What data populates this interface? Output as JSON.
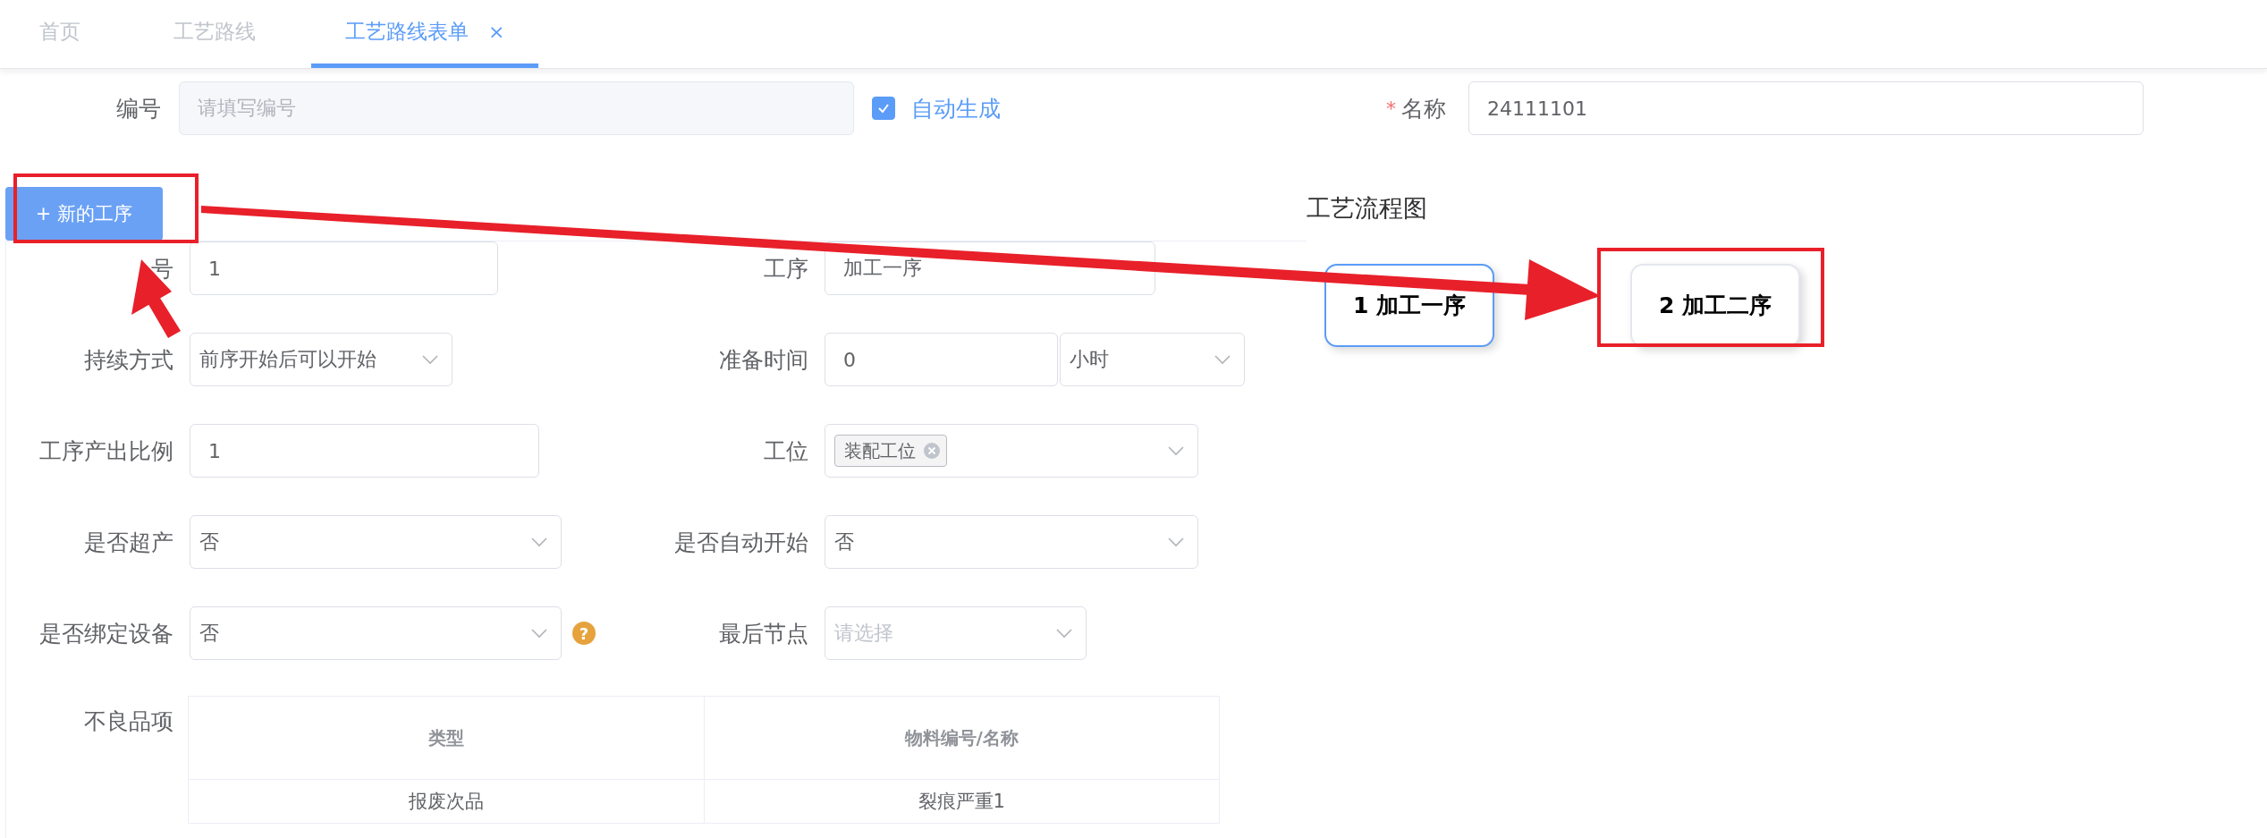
{
  "tabs": [
    {
      "label": "首页",
      "selected": false
    },
    {
      "label": "工艺路线",
      "selected": false
    },
    {
      "label": "工艺路线表单",
      "selected": true,
      "close": "×"
    }
  ],
  "header": {
    "code": {
      "label": "编号",
      "placeholder": "请填写编号",
      "disabled": true
    },
    "auto": {
      "label": "自动生成",
      "checked": true
    },
    "name": {
      "label": "名称",
      "required": true,
      "mark": "*",
      "value": "24111101"
    }
  },
  "add_button": "+ 新的工序",
  "fields": [
    {
      "label": "号",
      "kind": "input",
      "value": "1"
    },
    {
      "label": "工序",
      "kind": "input",
      "value": "加工一序"
    },
    {
      "label": "持续方式",
      "kind": "select",
      "value": "前序开始后可以开始"
    },
    {
      "label": "准备时间",
      "kind": "input_unit",
      "value": "0",
      "unit": "小时"
    },
    {
      "label": "工序产出比例",
      "kind": "input",
      "value": "1"
    },
    {
      "label": "工位",
      "kind": "tags",
      "tags": [
        "装配工位"
      ]
    },
    {
      "label": "是否超产",
      "kind": "select",
      "value": "否"
    },
    {
      "label": "是否自动开始",
      "kind": "select",
      "value": "否"
    },
    {
      "label": "是否绑定设备",
      "kind": "select",
      "value": "否",
      "help": "?"
    },
    {
      "label": "最后节点",
      "kind": "select",
      "placeholder": "请选择"
    }
  ],
  "defects": {
    "label": "不良品项",
    "columns": [
      "类型",
      "物料编号/名称"
    ],
    "rows": [
      [
        "报废次品",
        "裂痕严重1"
      ]
    ]
  },
  "flow": {
    "title": "工艺流程图",
    "nodes": [
      {
        "label": "1 加工一序",
        "selected": true
      },
      {
        "label": "2 加工二序",
        "selected": false
      }
    ]
  }
}
